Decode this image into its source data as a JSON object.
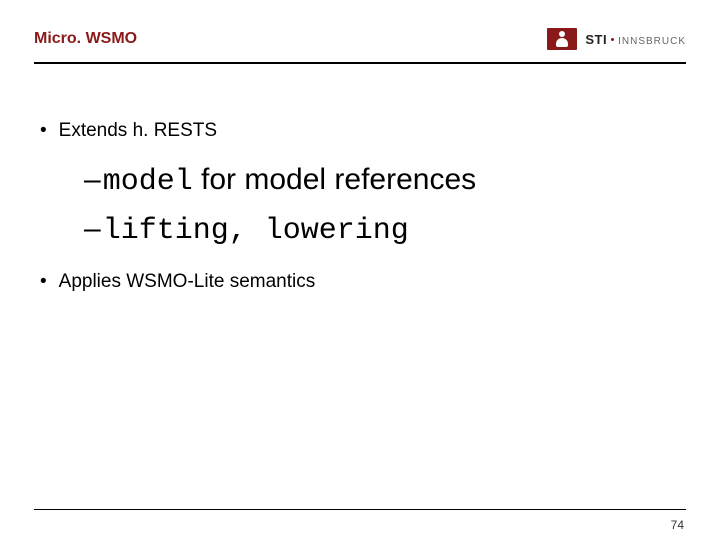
{
  "header": {
    "title": "Micro. WSMO",
    "logo": {
      "sti": "STI",
      "inn": "INNSBRUCK"
    }
  },
  "content": {
    "bullet_extends": "Extends h. RESTS",
    "sub_model_code": "model",
    "sub_model_rest": " for model references",
    "sub_lifting": "lifting, lowering",
    "bullet_applies": "Applies WSMO-Lite semantics"
  },
  "page": {
    "number": "74"
  }
}
